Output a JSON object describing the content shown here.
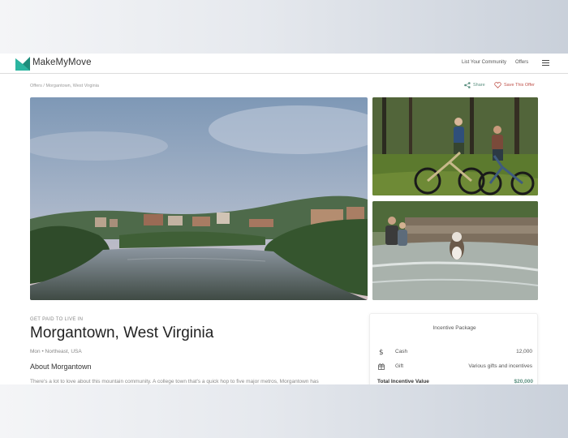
{
  "header": {
    "brand": "MakeMyMove",
    "nav": [
      "List Your Community",
      "Offers"
    ],
    "menu_icon": "hamburger-icon"
  },
  "breadcrumb": "Offers / Morgantown, West Virginia",
  "actions": {
    "share_label": "Share",
    "save_label": "Save This Offer",
    "share_icon": "share-icon",
    "save_icon": "heart-icon"
  },
  "colors": {
    "accent_green": "#5a8f7f",
    "save_red": "#c0544c",
    "logo_teal": "#2bb5a0",
    "logo_dark": "#1f5f57"
  },
  "listing": {
    "eyebrow": "GET PAID TO LIVE IN",
    "title": "Morgantown, West Virginia",
    "subtitle": "Mon • Northeast, USA",
    "about_title": "About Morgantown",
    "about_text": "There's a lot to love about this mountain community. A college town that's a quick hop to five major metros, Morgantown has"
  },
  "incentive": {
    "title": "Incentive Package",
    "rows": [
      {
        "icon": "dollar-icon",
        "label": "Cash",
        "value": "12,000"
      },
      {
        "icon": "gift-icon",
        "label": "Gift",
        "value": "Various gifts and incentives"
      }
    ],
    "total_label": "Total Incentive Value",
    "total_value": "$20,000"
  }
}
